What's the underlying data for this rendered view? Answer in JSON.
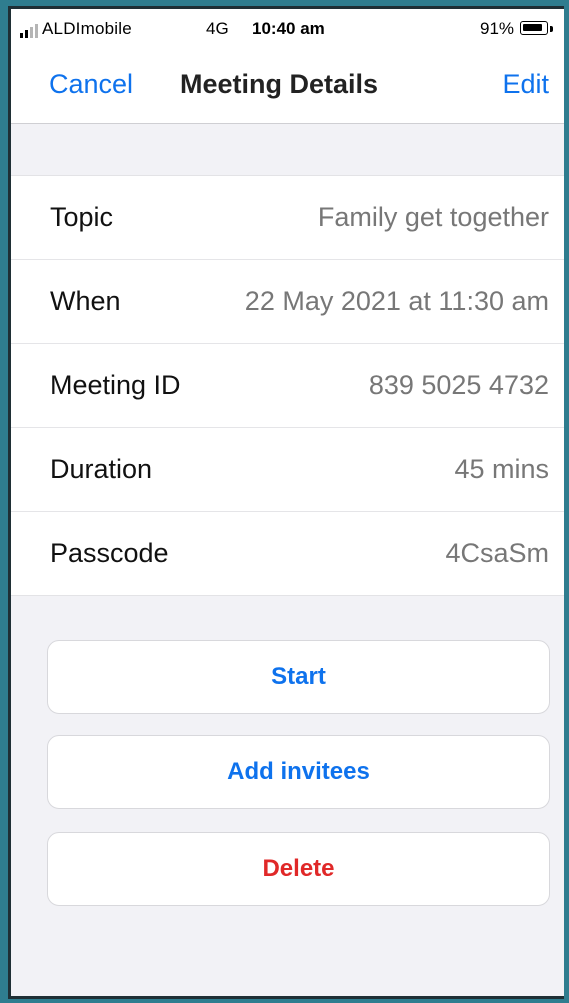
{
  "status_bar": {
    "carrier": "ALDImobile",
    "network": "4G",
    "time": "10:40 am",
    "battery_percent": "91%",
    "battery_level": 0.91,
    "signal_bars": 4,
    "signal_bars_active": 2
  },
  "nav": {
    "cancel_label": "Cancel",
    "title": "Meeting Details",
    "edit_label": "Edit"
  },
  "details": [
    {
      "label": "Topic",
      "value": "Family get together"
    },
    {
      "label": "When",
      "value": "22 May 2021 at 11:30 am"
    },
    {
      "label": "Meeting ID",
      "value": "839 5025 4732"
    },
    {
      "label": "Duration",
      "value": "45 mins"
    },
    {
      "label": "Passcode",
      "value": "4CsaSm"
    }
  ],
  "actions": {
    "start_label": "Start",
    "add_invitees_label": "Add invitees",
    "delete_label": "Delete"
  },
  "colors": {
    "accent": "#0e72ed",
    "danger": "#e02828",
    "background": "#f2f2f6"
  }
}
